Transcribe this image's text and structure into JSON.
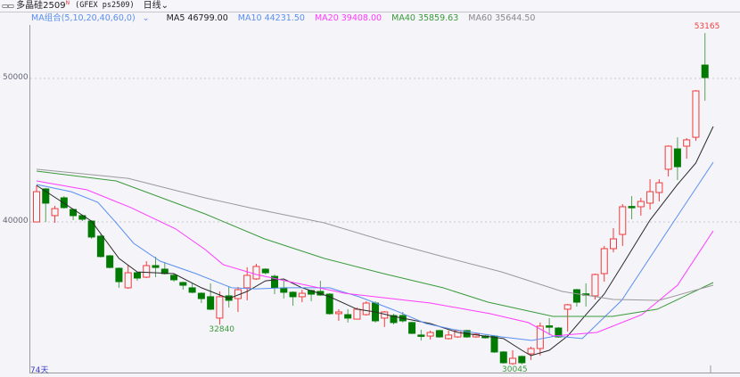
{
  "title": {
    "symbol": "多晶硅2509",
    "badge": "N",
    "code": "(GFEX ps2509)",
    "period": "日线",
    "period_chevron": "chevron-down-icon"
  },
  "legend": {
    "group_label": "MA组合(5,10,20,40,60,0)",
    "ma5": "MA5 46799.00",
    "ma10": "MA10 44231.50",
    "ma20": "MA20 39408.00",
    "ma40": "MA40 35859.63",
    "ma60": "MA60 35644.50"
  },
  "footer": {
    "days": "74天"
  },
  "colors": {
    "up": "#f03c3c",
    "down": "#007a00",
    "ma5": "#2a2a2a",
    "ma10": "#5b8ff0",
    "ma20": "#ff3cff",
    "ma40": "#3a9a3a",
    "ma60": "#9a9a9a",
    "bg": "#f4f4f9"
  },
  "chart_data": {
    "type": "candlestick",
    "yticks": [
      "50000",
      "40000"
    ],
    "ytick_values": [
      50000,
      40000
    ],
    "annotations": {
      "high": "53165",
      "low1": "32840",
      "low2": "30045"
    },
    "annotation_points": {
      "high": [
        73,
        53165
      ],
      "low1": [
        20,
        32840
      ],
      "low2": [
        52,
        30045
      ]
    },
    "candles_ohlc": [
      [
        40000,
        42110,
        42550,
        40000
      ],
      [
        42300,
        41310,
        42360,
        40000
      ],
      [
        40440,
        40930,
        41120,
        39940
      ],
      [
        41680,
        41000,
        41800,
        40930
      ],
      [
        40870,
        40440,
        40930,
        40130
      ],
      [
        40440,
        40190,
        40500,
        40060
      ],
      [
        40060,
        38950,
        40120,
        38820
      ],
      [
        39010,
        37590,
        39130,
        37520
      ],
      [
        37640,
        36830,
        37700,
        36770
      ],
      [
        36770,
        35840,
        36830,
        35410
      ],
      [
        35410,
        36460,
        36960,
        35340
      ],
      [
        36460,
        36090,
        36520,
        35900
      ],
      [
        36150,
        36960,
        37270,
        36090
      ],
      [
        36960,
        36830,
        37580,
        36150
      ],
      [
        36710,
        36400,
        37210,
        36340
      ],
      [
        36280,
        35970,
        36400,
        35840
      ],
      [
        35780,
        35590,
        35840,
        35280
      ],
      [
        35410,
        35100,
        35720,
        35030
      ],
      [
        35030,
        34660,
        35100,
        34350
      ],
      [
        34790,
        33920,
        35720,
        33860
      ],
      [
        33300,
        34790,
        35160,
        32840
      ],
      [
        34850,
        34540,
        35470,
        34040
      ],
      [
        34660,
        35280,
        35470,
        33730
      ],
      [
        35410,
        36280,
        36840,
        34540
      ],
      [
        36030,
        36900,
        37080,
        35970
      ],
      [
        36710,
        36460,
        36770,
        36340
      ],
      [
        36210,
        35410,
        36340,
        34970
      ],
      [
        35410,
        35100,
        35900,
        34660
      ],
      [
        35100,
        34790,
        35160,
        34160
      ],
      [
        34790,
        35030,
        35280,
        34410
      ],
      [
        35220,
        34970,
        35280,
        34470
      ],
      [
        35160,
        34910,
        35900,
        34850
      ],
      [
        34970,
        33610,
        35030,
        33540
      ],
      [
        33610,
        33730,
        33920,
        33110
      ],
      [
        33540,
        33300,
        33920,
        32990
      ],
      [
        33230,
        33920,
        34040,
        33230
      ],
      [
        33540,
        34350,
        34470,
        33480
      ],
      [
        34350,
        33110,
        34470,
        32990
      ],
      [
        33300,
        33730,
        33790,
        32680
      ],
      [
        33480,
        32990,
        33610,
        32860
      ],
      [
        33480,
        33110,
        33730,
        32990
      ],
      [
        32990,
        32240,
        33050,
        32180
      ],
      [
        32120,
        32050,
        32490,
        31740
      ],
      [
        32050,
        32300,
        32430,
        31810
      ],
      [
        32430,
        31990,
        32490,
        31930
      ],
      [
        31870,
        32120,
        32430,
        31810
      ],
      [
        31990,
        32430,
        32490,
        31930
      ],
      [
        32430,
        31990,
        32490,
        31930
      ],
      [
        31990,
        32180,
        32240,
        31930
      ],
      [
        32050,
        31930,
        32120,
        31870
      ],
      [
        32050,
        30940,
        32120,
        30880
      ],
      [
        30940,
        30190,
        31000,
        30130
      ],
      [
        30130,
        30500,
        31060,
        30045
      ],
      [
        30630,
        30190,
        30690,
        30070
      ],
      [
        30810,
        31180,
        31310,
        30380
      ],
      [
        31180,
        32740,
        32990,
        30690
      ],
      [
        32760,
        32720,
        33300,
        32120
      ],
      [
        32610,
        31990,
        32670,
        31930
      ],
      [
        33920,
        34230,
        34290,
        32360
      ],
      [
        35280,
        34410,
        35340,
        34100
      ],
      [
        34990,
        34950,
        35720,
        34100
      ],
      [
        34850,
        36340,
        36400,
        34600
      ],
      [
        36400,
        38140,
        38330,
        35840
      ],
      [
        38140,
        38820,
        39570,
        37890
      ],
      [
        39130,
        41060,
        41240,
        38330
      ],
      [
        41080,
        41030,
        41800,
        40190
      ],
      [
        41060,
        41430,
        41680,
        40440
      ],
      [
        41310,
        42110,
        42980,
        40870
      ],
      [
        42050,
        42730,
        42980,
        41430
      ],
      [
        43670,
        45280,
        45340,
        43170
      ],
      [
        45090,
        43850,
        45900,
        42920
      ],
      [
        45280,
        45720,
        45840,
        44410
      ],
      [
        45900,
        49130,
        49190,
        45650
      ],
      [
        50930,
        50060,
        53165,
        48450
      ]
    ],
    "series": [
      {
        "name": "MA5",
        "points": [
          [
            0,
            42550
          ],
          [
            6,
            40060
          ],
          [
            9,
            37460
          ],
          [
            11,
            36520
          ],
          [
            15,
            36400
          ],
          [
            18,
            35410
          ],
          [
            21,
            34660
          ],
          [
            23,
            35160
          ],
          [
            25,
            35900
          ],
          [
            27,
            36030
          ],
          [
            29,
            35410
          ],
          [
            32,
            34790
          ],
          [
            35,
            33920
          ],
          [
            37,
            33730
          ],
          [
            39,
            33420
          ],
          [
            43,
            32920
          ],
          [
            46,
            32300
          ],
          [
            51,
            31870
          ],
          [
            53,
            31060
          ],
          [
            54,
            30690
          ],
          [
            56,
            31060
          ],
          [
            58,
            32050
          ],
          [
            60,
            33540
          ],
          [
            62,
            34970
          ],
          [
            64,
            37020
          ],
          [
            67,
            40130
          ],
          [
            70,
            42610
          ],
          [
            72,
            44100
          ],
          [
            73.9,
            46650
          ]
        ]
      },
      {
        "name": "MA10",
        "points": [
          [
            0,
            42610
          ],
          [
            3.8,
            42110
          ],
          [
            6.7,
            41370
          ],
          [
            8.7,
            39940
          ],
          [
            10.6,
            38510
          ],
          [
            13.5,
            37270
          ],
          [
            17.4,
            36400
          ],
          [
            21.3,
            35410
          ],
          [
            24,
            35340
          ],
          [
            27.2,
            35410
          ],
          [
            32,
            35410
          ],
          [
            35.2,
            34790
          ],
          [
            39.1,
            33850
          ],
          [
            42.5,
            32920
          ],
          [
            45.7,
            32490
          ],
          [
            50.8,
            31990
          ],
          [
            54.1,
            31740
          ],
          [
            56.7,
            32050
          ],
          [
            59.6,
            31870
          ],
          [
            63.9,
            34540
          ],
          [
            66.1,
            36650
          ],
          [
            69.3,
            39750
          ],
          [
            73.9,
            44160
          ]
        ]
      },
      {
        "name": "MA20",
        "points": [
          [
            0,
            42860
          ],
          [
            5.5,
            42240
          ],
          [
            10.3,
            41000
          ],
          [
            15.2,
            39510
          ],
          [
            18.4,
            38080
          ],
          [
            20.4,
            37020
          ],
          [
            24,
            36340
          ],
          [
            27.2,
            35900
          ],
          [
            30.4,
            35470
          ],
          [
            33.7,
            35030
          ],
          [
            36.9,
            34790
          ],
          [
            43,
            34350
          ],
          [
            49.5,
            33610
          ],
          [
            53.7,
            32990
          ],
          [
            56.4,
            32050
          ],
          [
            61.2,
            32300
          ],
          [
            66.1,
            33540
          ],
          [
            70,
            35590
          ],
          [
            73.9,
            39380
          ]
        ]
      },
      {
        "name": "MA40",
        "points": [
          [
            0,
            43540
          ],
          [
            8.7,
            42860
          ],
          [
            18.4,
            40560
          ],
          [
            24.9,
            38820
          ],
          [
            31.4,
            37460
          ],
          [
            37.9,
            36400
          ],
          [
            44.4,
            35410
          ],
          [
            49.3,
            34410
          ],
          [
            56.4,
            33420
          ],
          [
            62.9,
            33420
          ],
          [
            67.8,
            33920
          ],
          [
            73.9,
            35780
          ]
        ]
      },
      {
        "name": "MA60",
        "points": [
          [
            0,
            43670
          ],
          [
            10,
            43040
          ],
          [
            18.4,
            41680
          ],
          [
            23.3,
            40990
          ],
          [
            31.4,
            39940
          ],
          [
            37.9,
            38700
          ],
          [
            44.4,
            37580
          ],
          [
            50.8,
            36520
          ],
          [
            57.4,
            35160
          ],
          [
            63,
            34600
          ],
          [
            68,
            34540
          ],
          [
            73.9,
            35590
          ]
        ]
      }
    ]
  }
}
